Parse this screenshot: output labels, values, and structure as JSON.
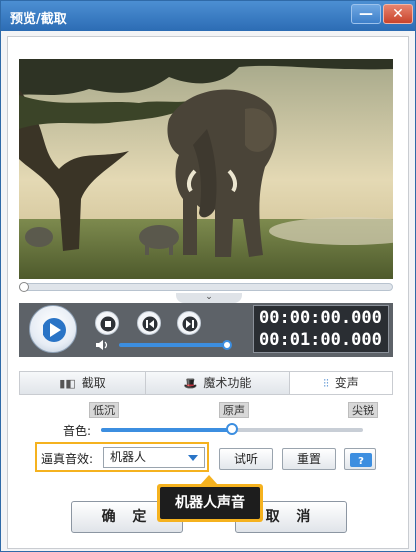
{
  "window": {
    "title": "预览/截取",
    "minimize_label": "—",
    "close_label": "✕"
  },
  "player": {
    "time_current": "00:00:00.000",
    "time_total": "00:01:00.000",
    "progress": 0.0,
    "volume": 0.95,
    "icons": [
      "play-icon",
      "stop-icon",
      "prev-frame-icon",
      "next-frame-icon",
      "volume-icon",
      "chevron-down-icon"
    ]
  },
  "tabs": [
    {
      "label": "截取",
      "icon": "trim-icon"
    },
    {
      "label": "魔术功能",
      "icon": "magic-hat-icon"
    },
    {
      "label": "变声",
      "icon": "voice-wave-icon",
      "active": true
    }
  ],
  "voice": {
    "pitch_low": "低沉",
    "pitch_original": "原声",
    "pitch_high": "尖锐",
    "timbre_label": "音色:",
    "timbre_value": 0.5,
    "effect_label": "逼真音效:",
    "effect_selected": "机器人",
    "listen_label": "试听",
    "reset_label": "重置"
  },
  "footer": {
    "ok_label": "确 定",
    "cancel_label": "取 消"
  },
  "tooltip": {
    "text": "机器人声音"
  },
  "colors": {
    "title_bar": "#2c6cb4",
    "accent": "#3c8ee0",
    "highlight": "#f5b21f",
    "control_panel": "#5d6268"
  }
}
